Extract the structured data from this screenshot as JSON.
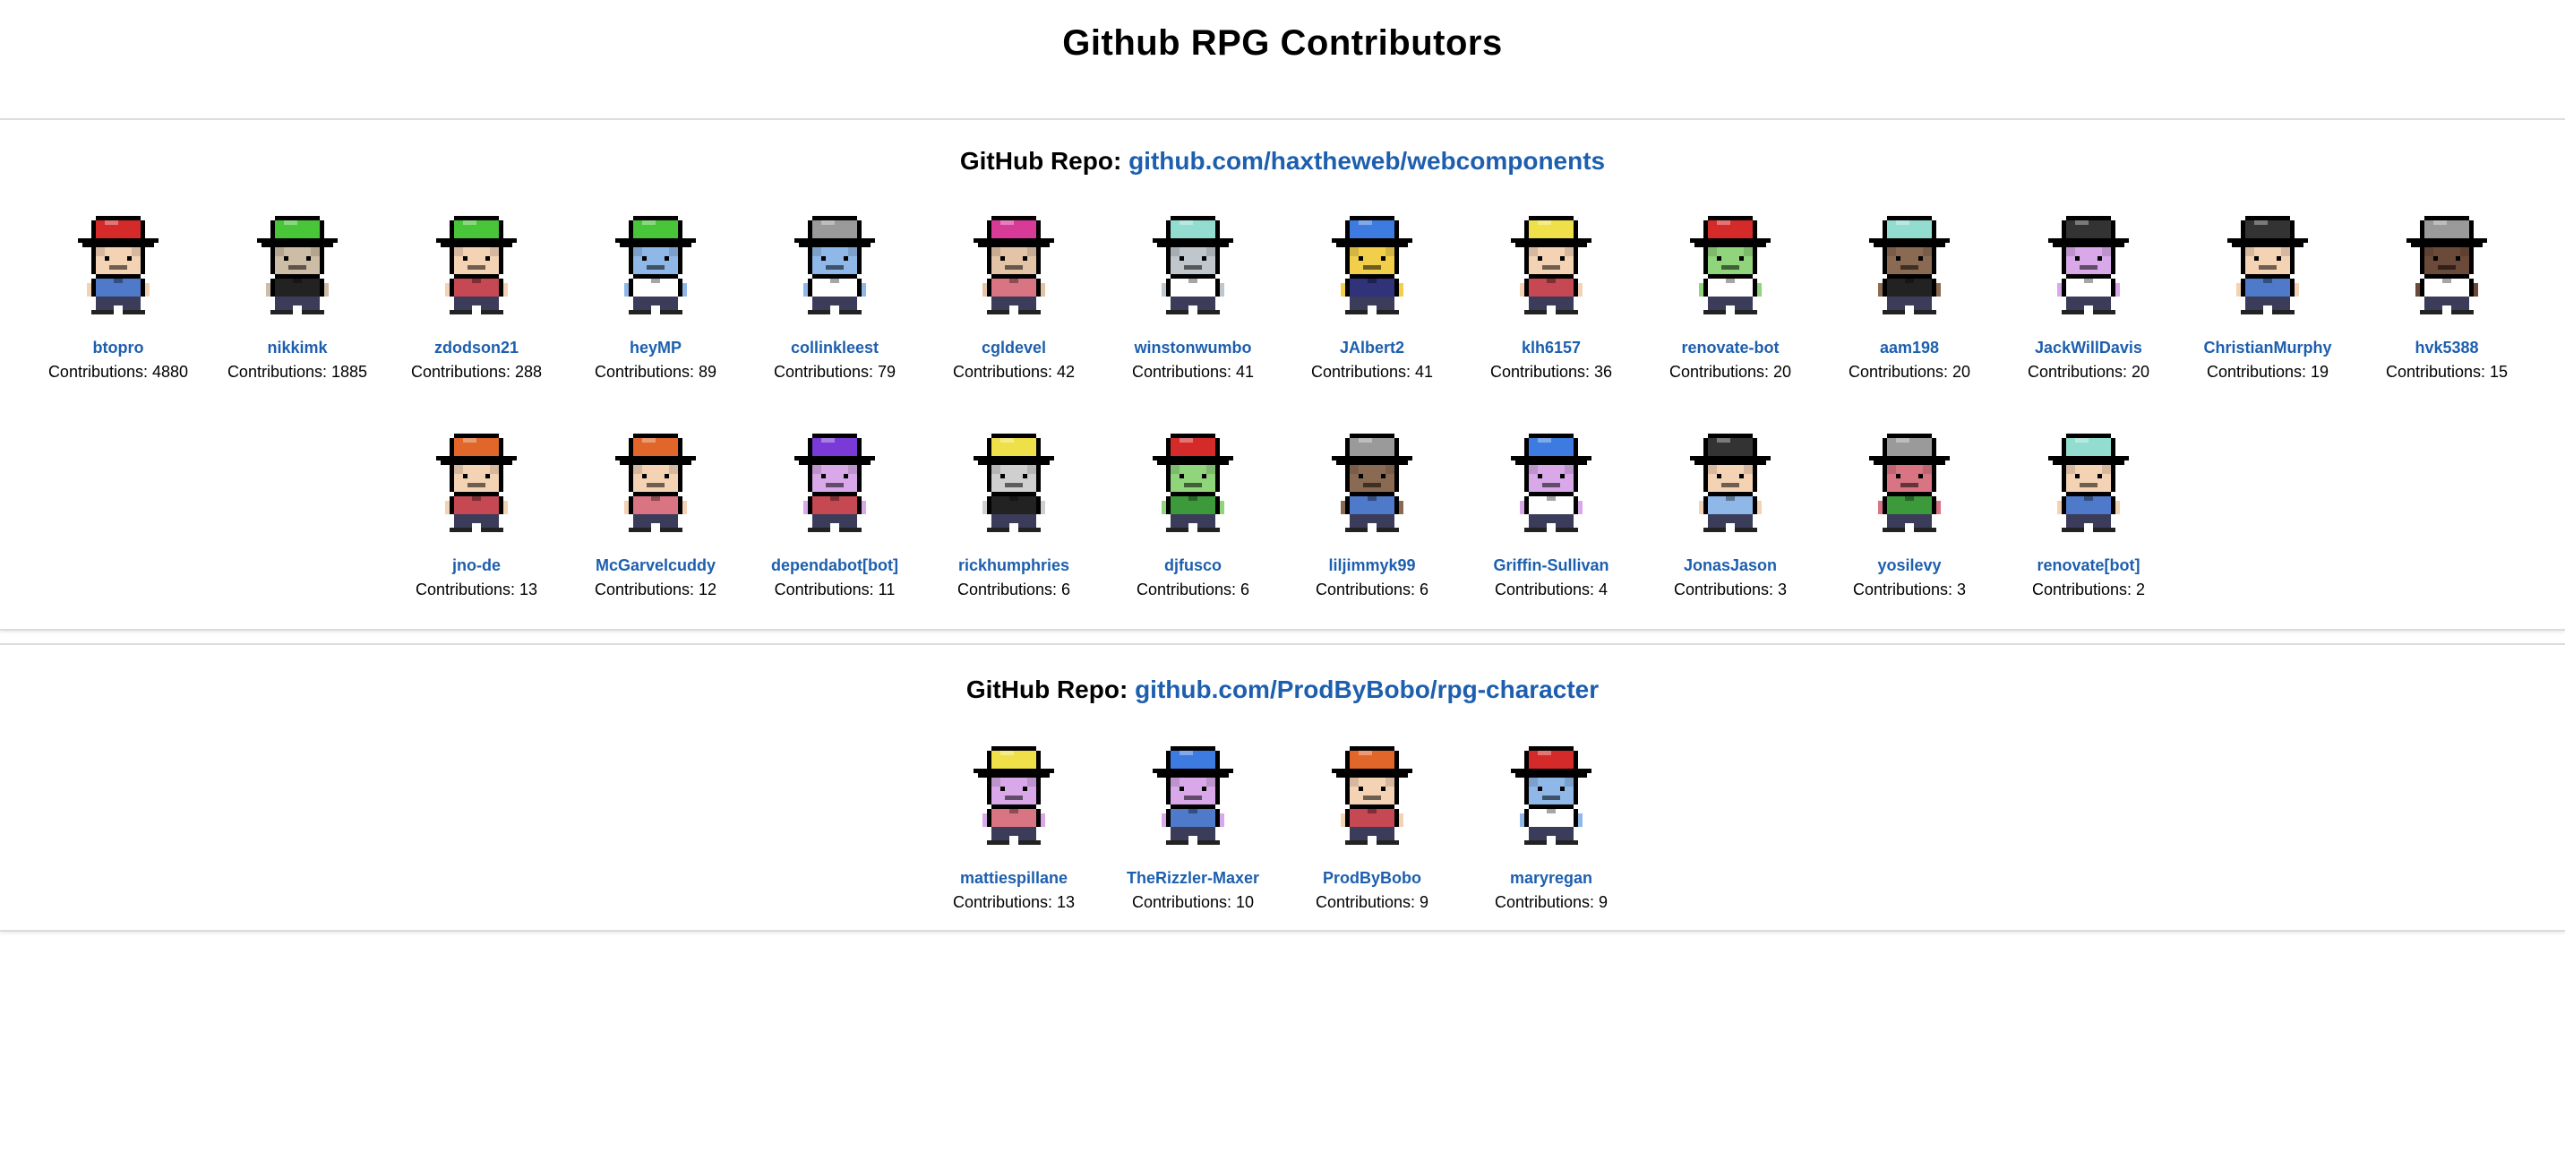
{
  "page": {
    "title": "Github RPG Contributors"
  },
  "repos": [
    {
      "label": "GitHub Repo:",
      "link": "github.com/haxtheweb/webcomponents",
      "rows": [
        [
          {
            "name": "btopro",
            "contrib": "Contributions: 4880",
            "hat": "#d42a2a",
            "skin": "#f4d2b4",
            "shirt": "#4f79c9"
          },
          {
            "name": "nikkimk",
            "contrib": "Contributions: 1885",
            "hat": "#49c53a",
            "skin": "#cdbca6",
            "shirt": "#222222"
          },
          {
            "name": "zdodson21",
            "contrib": "Contributions: 288",
            "hat": "#49c53a",
            "skin": "#f4d2b4",
            "shirt": "#c54852"
          },
          {
            "name": "heyMP",
            "contrib": "Contributions: 89",
            "hat": "#49c53a",
            "skin": "#8fb7e8",
            "shirt": "#ffffff"
          },
          {
            "name": "collinkleest",
            "contrib": "Contributions: 79",
            "hat": "#9a9a9a",
            "skin": "#8fb7e8",
            "shirt": "#ffffff"
          },
          {
            "name": "cgldevel",
            "contrib": "Contributions: 42",
            "hat": "#d83a97",
            "skin": "#e3c4a6",
            "shirt": "#d97483"
          },
          {
            "name": "winstonwumbo",
            "contrib": "Contributions: 41",
            "hat": "#92ddd0",
            "skin": "#bfc6cc",
            "shirt": "#ffffff"
          },
          {
            "name": "JAlbert2",
            "contrib": "Contributions: 41",
            "hat": "#3d7be0",
            "skin": "#f2cf4a",
            "shirt": "#30327a"
          },
          {
            "name": "klh6157",
            "contrib": "Contributions: 36",
            "hat": "#efe04a",
            "skin": "#f4d2b4",
            "shirt": "#c54852"
          },
          {
            "name": "renovate-bot",
            "contrib": "Contributions: 20",
            "hat": "#d42a2a",
            "skin": "#90d47c",
            "shirt": "#ffffff"
          },
          {
            "name": "aam198",
            "contrib": "Contributions: 20",
            "hat": "#92ddd0",
            "skin": "#8a6a52",
            "shirt": "#222222"
          },
          {
            "name": "JackWillDavis",
            "contrib": "Contributions: 20",
            "hat": "#333333",
            "skin": "#d8a8e8",
            "shirt": "#ffffff"
          },
          {
            "name": "ChristianMurphy",
            "contrib": "Contributions: 19",
            "hat": "#333333",
            "skin": "#f4d2b4",
            "shirt": "#4f79c9"
          },
          {
            "name": "hvk5388",
            "contrib": "Contributions: 15",
            "hat": "#9a9a9a",
            "skin": "#6b4a3a",
            "shirt": "#ffffff"
          }
        ],
        [
          {
            "name": "jno-de",
            "contrib": "Contributions: 13",
            "hat": "#e0662a",
            "skin": "#f4d2b4",
            "shirt": "#c54852"
          },
          {
            "name": "McGarvelcuddy",
            "contrib": "Contributions: 12",
            "hat": "#e0662a",
            "skin": "#f4d2b4",
            "shirt": "#d97483"
          },
          {
            "name": "dependabot[bot]",
            "contrib": "Contributions: 11",
            "hat": "#7a3ad8",
            "skin": "#d8a8e8",
            "shirt": "#c54852"
          },
          {
            "name": "rickhumphries",
            "contrib": "Contributions: 6",
            "hat": "#efe04a",
            "skin": "#cfcfcf",
            "shirt": "#222222"
          },
          {
            "name": "djfusco",
            "contrib": "Contributions: 6",
            "hat": "#d42a2a",
            "skin": "#90d47c",
            "shirt": "#3d9a3a"
          },
          {
            "name": "liljimmyk99",
            "contrib": "Contributions: 6",
            "hat": "#9a9a9a",
            "skin": "#8a6a52",
            "shirt": "#4f79c9"
          },
          {
            "name": "Griffin-Sullivan",
            "contrib": "Contributions: 4",
            "hat": "#3d7be0",
            "skin": "#d8a8e8",
            "shirt": "#ffffff"
          },
          {
            "name": "JonasJason",
            "contrib": "Contributions: 3",
            "hat": "#333333",
            "skin": "#f4d2b4",
            "shirt": "#8fb7e8"
          },
          {
            "name": "yosilevy",
            "contrib": "Contributions: 3",
            "hat": "#9a9a9a",
            "skin": "#d97483",
            "shirt": "#3d9a3a"
          },
          {
            "name": "renovate[bot]",
            "contrib": "Contributions: 2",
            "hat": "#92ddd0",
            "skin": "#f4d2b4",
            "shirt": "#4f79c9"
          }
        ]
      ]
    },
    {
      "label": "GitHub Repo:",
      "link": "github.com/ProdByBobo/rpg-character",
      "rows": [
        [
          {
            "name": "mattiespillane",
            "contrib": "Contributions: 13",
            "hat": "#efe04a",
            "skin": "#d8a8e8",
            "shirt": "#d97483"
          },
          {
            "name": "TheRizzler-Maxer",
            "contrib": "Contributions: 10",
            "hat": "#3d7be0",
            "skin": "#d8a8e8",
            "shirt": "#4f79c9"
          },
          {
            "name": "ProdByBobo",
            "contrib": "Contributions: 9",
            "hat": "#e0662a",
            "skin": "#f4d2b4",
            "shirt": "#c54852"
          },
          {
            "name": "maryregan",
            "contrib": "Contributions: 9",
            "hat": "#d42a2a",
            "skin": "#8fb7e8",
            "shirt": "#ffffff"
          }
        ]
      ]
    }
  ]
}
